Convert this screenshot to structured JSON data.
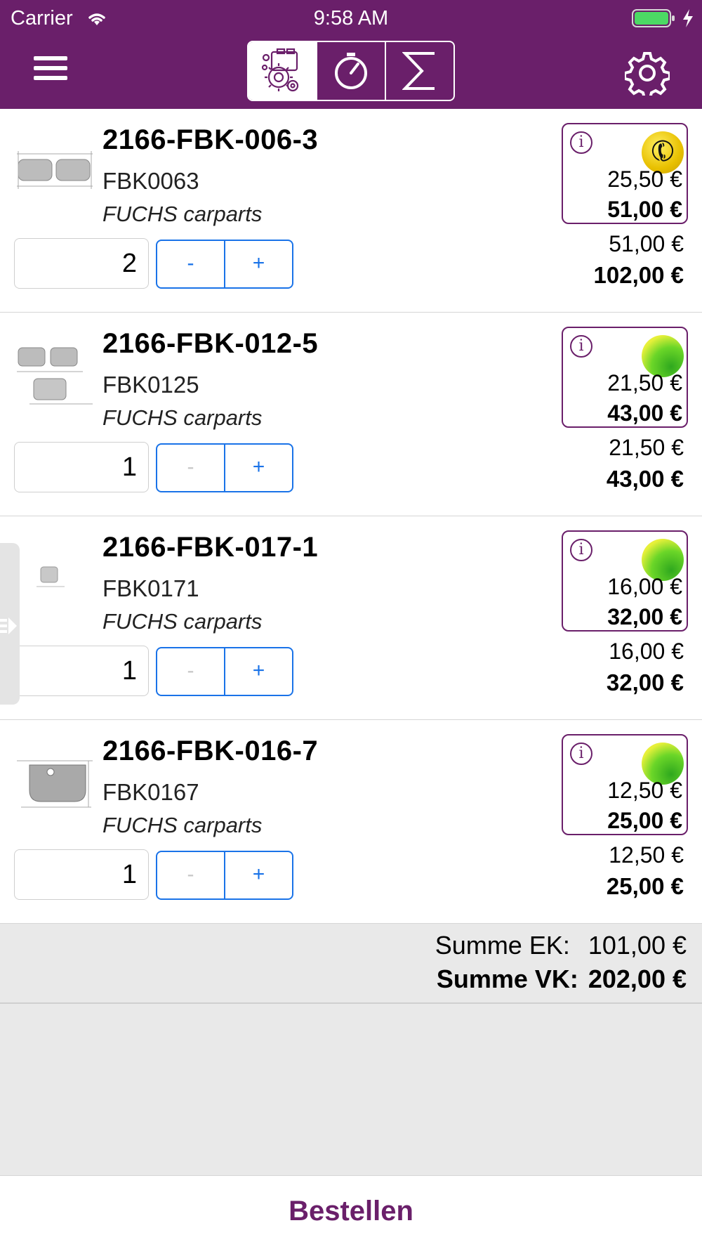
{
  "status_bar": {
    "carrier": "Carrier",
    "time": "9:58 AM"
  },
  "toolbar": {
    "menu_icon": "hamburger-icon",
    "tabs": [
      {
        "icon": "parts-gear-icon",
        "selected": true
      },
      {
        "icon": "stopwatch-icon",
        "selected": false
      },
      {
        "icon": "sigma-icon",
        "selected": false
      }
    ],
    "settings_icon": "gear-icon"
  },
  "items": [
    {
      "title": "2166-FBK-006-3",
      "code": "FBK0063",
      "brand": "FUCHS carparts",
      "qty": "2",
      "minus": "-",
      "plus": "+",
      "minus_enabled": true,
      "availability": "phone",
      "info": "i",
      "unit_ek": "25,50 €",
      "unit_vk": "51,00 €",
      "total_ek": "51,00 €",
      "total_vk": "102,00 €"
    },
    {
      "title": "2166-FBK-012-5",
      "code": "FBK0125",
      "brand": "FUCHS carparts",
      "qty": "1",
      "minus": "-",
      "plus": "+",
      "minus_enabled": false,
      "availability": "green",
      "info": "i",
      "unit_ek": "21,50 €",
      "unit_vk": "43,00 €",
      "total_ek": "21,50 €",
      "total_vk": "43,00 €"
    },
    {
      "title": "2166-FBK-017-1",
      "code": "FBK0171",
      "brand": "FUCHS carparts",
      "qty": "1",
      "minus": "-",
      "plus": "+",
      "minus_enabled": false,
      "availability": "green",
      "info": "i",
      "unit_ek": "16,00 €",
      "unit_vk": "32,00 €",
      "total_ek": "16,00 €",
      "total_vk": "32,00 €"
    },
    {
      "title": "2166-FBK-016-7",
      "code": "FBK0167",
      "brand": "FUCHS carparts",
      "qty": "1",
      "minus": "-",
      "plus": "+",
      "minus_enabled": false,
      "availability": "green",
      "info": "i",
      "unit_ek": "12,50 €",
      "unit_vk": "25,00 €",
      "total_ek": "12,50 €",
      "total_vk": "25,00 €"
    }
  ],
  "summary": {
    "ek_label": "Summe EK:",
    "ek_value": "101,00 €",
    "vk_label": "Summe VK:",
    "vk_value": "202,00 €"
  },
  "footer": {
    "order_label": "Bestellen"
  },
  "colors": {
    "brand": "#6a1f6a",
    "accent": "#1a73e8"
  }
}
